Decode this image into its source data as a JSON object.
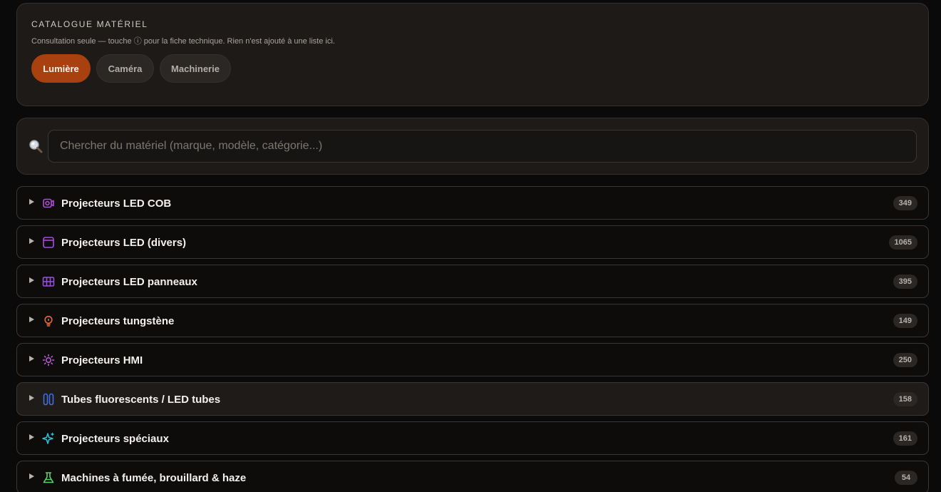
{
  "header": {
    "title": "CATALOGUE MATÉRIEL",
    "subtitle": "Consultation seule — touche ⓘ pour la fiche technique. Rien n'est ajouté à une liste ici.",
    "tabs": [
      {
        "label": "Lumière",
        "active": true
      },
      {
        "label": "Caméra",
        "active": false
      },
      {
        "label": "Machinerie",
        "active": false
      }
    ]
  },
  "search": {
    "placeholder": "Chercher du matériel (marque, modèle, catégorie...)",
    "value": "",
    "icon": "magnifier-icon"
  },
  "categories": [
    {
      "label": "Projecteurs LED COB",
      "count": "349",
      "icon": "cob-projector-icon",
      "color": "#b14ad6"
    },
    {
      "label": "Projecteurs LED (divers)",
      "count": "1065",
      "icon": "panel-window-icon",
      "color": "#a44de0"
    },
    {
      "label": "Projecteurs LED panneaux",
      "count": "395",
      "icon": "grid-panel-icon",
      "color": "#9a4fe6"
    },
    {
      "label": "Projecteurs tungstène",
      "count": "149",
      "icon": "bulb-icon",
      "color": "#e06a3a"
    },
    {
      "label": "Projecteurs HMI",
      "count": "250",
      "icon": "sun-icon",
      "color": "#c05fe0"
    },
    {
      "label": "Tubes fluorescents / LED tubes",
      "count": "158",
      "icon": "tubes-icon",
      "color": "#3f6fe0"
    },
    {
      "label": "Projecteurs spéciaux",
      "count": "161",
      "icon": "sparkle-icon",
      "color": "#2bc3d6"
    },
    {
      "label": "Machines à fumée, brouillard & haze",
      "count": "54",
      "icon": "smoke-machine-icon",
      "color": "#5fcf6a"
    }
  ]
}
